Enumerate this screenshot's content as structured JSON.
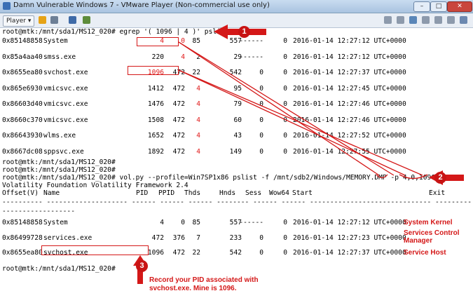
{
  "window": {
    "title": "Damn Vulnerable Windows 7 - VMware Player (Non-commercial use only)",
    "player_menu": "Player",
    "player_arrow": "▾"
  },
  "terminal": {
    "cmd1": "root@mtk:/mnt/sda1/MS12_020# egrep '( 1096 | 4 )' pslist.txt",
    "grep_rows": [
      {
        "off": "0x85148858",
        "name": "System",
        "pid": "4",
        "ppid": "0",
        "thds": "85",
        "hnds": "557",
        "sess": "------",
        "wow": "0",
        "start": "2016-01-14 12:27:12 UTC+0000"
      },
      {
        "off": "0x85a4aa40",
        "name": "smss.exe",
        "pid": "220",
        "ppid": "4",
        "thds": "2",
        "hnds": "29",
        "sess": "------",
        "wow": "0",
        "start": "2016-01-14 12:27:12 UTC+0000"
      },
      {
        "off": "0x8655ea80",
        "name": "svchost.exe",
        "pid": "1096",
        "ppid": "472",
        "thds": "22",
        "hnds": "542",
        "sess": "0",
        "wow": "0",
        "start": "2016-01-14 12:27:37 UTC+0000"
      },
      {
        "off": "0x865e6930",
        "name": "vmicsvc.exe",
        "pid": "1412",
        "ppid": "472",
        "thds": "4",
        "hnds": "95",
        "sess": "0",
        "wow": "0",
        "start": "2016-01-14 12:27:45 UTC+0000"
      },
      {
        "off": "0x86603d40",
        "name": "vmicsvc.exe",
        "pid": "1476",
        "ppid": "472",
        "thds": "4",
        "hnds": "79",
        "sess": "0",
        "wow": "0",
        "start": "2016-01-14 12:27:46 UTC+0000"
      },
      {
        "off": "0x8660c370",
        "name": "vmicsvc.exe",
        "pid": "1508",
        "ppid": "472",
        "thds": "4",
        "hnds": "60",
        "sess": "0",
        "wow": "0",
        "start": "2016-01-14 12:27:46 UTC+0000"
      },
      {
        "off": "0x86643930",
        "name": "wlms.exe",
        "pid": "1652",
        "ppid": "472",
        "thds": "4",
        "hnds": "43",
        "sess": "0",
        "wow": "0",
        "start": "2016-01-14 12:27:52 UTC+0000"
      },
      {
        "off": "0x8667dc08",
        "name": "sppsvc.exe",
        "pid": "1892",
        "ppid": "472",
        "thds": "4",
        "hnds": "149",
        "sess": "0",
        "wow": "0",
        "start": "2016-01-14 12:27:55 UTC+0000"
      }
    ],
    "prompt2": "root@mtk:/mnt/sda1/MS12_020#",
    "prompt3": "root@mtk:/mnt/sda1/MS12_020#",
    "cmd2": "root@mtk:/mnt/sda1/MS12_020# vol.py --profile=Win7SP1x86 pslist -f /mnt/sdb2/Windows/MEMORY.DMP -p 4,0,1096,472",
    "vol_banner": "Volatility Foundation Volatility Framework 2.4",
    "headers": {
      "off": "Offset(V)",
      "name": "Name",
      "pid": "PID",
      "ppid": "PPID",
      "thds": "Thds",
      "hnds": "Hnds",
      "sess": "Sess",
      "wow": "Wow64",
      "start": "Start",
      "exit": "Exit"
    },
    "sep1": "---------- -------------------- ------ ------ ------ -------- ------ ------ ------------------------------ ------------------------------",
    "sep2": "------------------",
    "vol_rows": [
      {
        "off": "0x85148858",
        "name": "System",
        "pid": "4",
        "ppid": "0",
        "thds": "85",
        "hnds": "557",
        "sess": "------",
        "wow": "0",
        "start": "2016-01-14 12:27:12 UTC+0000"
      },
      {
        "off": "0x86499728",
        "name": "services.exe",
        "pid": "472",
        "ppid": "376",
        "thds": "7",
        "hnds": "233",
        "sess": "0",
        "wow": "0",
        "start": "2016-01-14 12:27:23 UTC+0000"
      },
      {
        "off": "0x8655ea80",
        "name": "svchost.exe",
        "pid": "1096",
        "ppid": "472",
        "thds": "22",
        "hnds": "542",
        "sess": "0",
        "wow": "0",
        "start": "2016-01-14 12:27:37 UTC+0000"
      }
    ],
    "prompt4": "root@mtk:/mnt/sda1/MS12_020#"
  },
  "annotations": {
    "badge1": "1",
    "badge2": "2",
    "badge3": "3",
    "label_system": "System Kernel",
    "label_services_1": "Services Control",
    "label_services_2": "Manager",
    "label_svchost": "Service Host",
    "note_1": "Record your PID associated with",
    "note_2": "svchost.exe.  Mine is 1096."
  },
  "colors": {
    "annotation_red": "#d41818",
    "terminal_text": "#000000",
    "background": "#ffffff"
  }
}
